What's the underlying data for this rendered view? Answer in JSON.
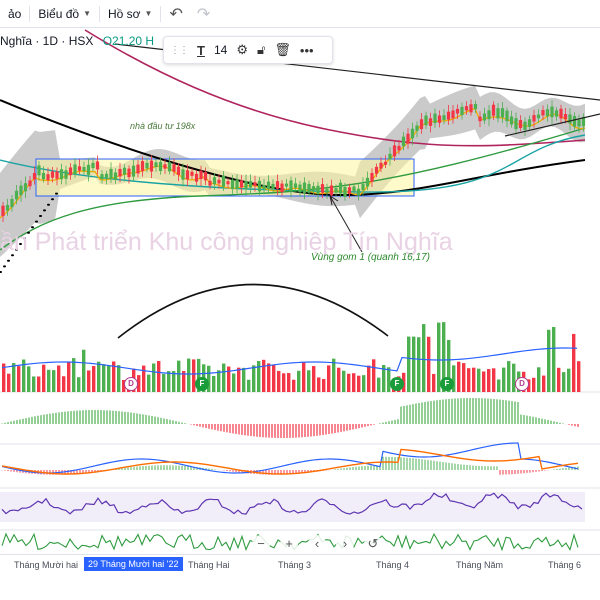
{
  "topbar": {
    "partial_left": "ảo",
    "charts_label": "Biểu đồ",
    "profile_label": "Hồ sơ"
  },
  "symbol": {
    "title": "Nghĩa · 1D · HSX",
    "ohlc": "O21.20 H"
  },
  "drawing_toolbar": {
    "text_icon": "text-icon",
    "font_size": "14",
    "icons": [
      "settings-icon",
      "lock-icon",
      "trash-icon",
      "more-icon"
    ]
  },
  "watermark": "ần Phát triển Khu công nghiệp Tín Nghĩa",
  "annotations": {
    "investor": "nhà đầu tư 198x",
    "zone": "Vùng gom 1 (quanh 16,17)"
  },
  "badges": [
    {
      "letter": "D",
      "kind": "dividend"
    },
    {
      "letter": "F",
      "kind": "financials"
    },
    {
      "letter": "F",
      "kind": "financials"
    },
    {
      "letter": "F",
      "kind": "financials"
    },
    {
      "letter": "D",
      "kind": "dividend"
    }
  ],
  "time_axis": [
    {
      "label": "Tháng Mười hai",
      "active": false
    },
    {
      "label": "29 Tháng Mười hai '22",
      "active": true
    },
    {
      "label": "Tháng Hai",
      "active": false
    },
    {
      "label": "Tháng 3",
      "active": false
    },
    {
      "label": "Tháng 4",
      "active": false
    },
    {
      "label": "Tháng Năm",
      "active": false
    },
    {
      "label": "Tháng 6",
      "active": false
    }
  ],
  "colors": {
    "up": "#4caf50",
    "down": "#f23645",
    "ma_black": "#000000",
    "ma_maroon": "#b0245d",
    "bollinger_fill": "#9e9e9e",
    "accent": "#2962ff"
  }
}
